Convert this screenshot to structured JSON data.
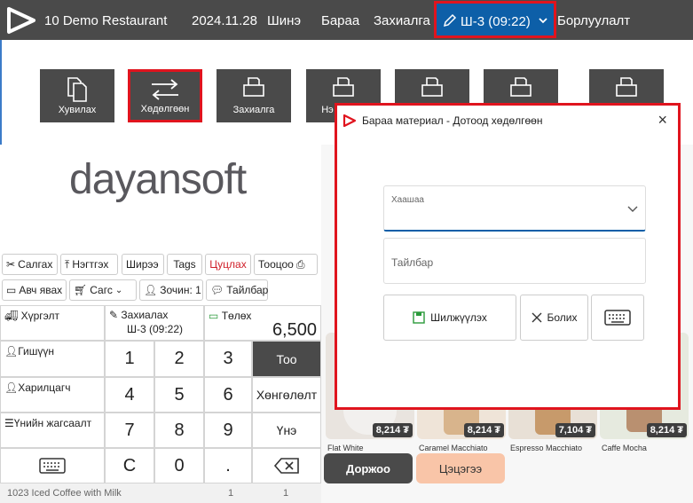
{
  "header": {
    "restaurant": "10 Demo Restaurant",
    "date": "2024.11.28",
    "menu": [
      "Шинэ",
      "Бараа",
      "Захиалга"
    ],
    "order_tab": "Ш-3 (09:22)",
    "sales": "Борлуулалт"
  },
  "actions": [
    "Хувилах",
    "Хөдөлгөөн",
    "Захиалга",
    "Нэ"
  ],
  "brand": "dayansoft",
  "toolbar": {
    "row1": [
      "Салгах",
      "Нэгтгэх",
      "Ширээ",
      "Tags",
      "Цуцлах",
      "Тооцоо"
    ],
    "row2": [
      "Авч явах",
      "Сагс",
      "Зочин: 1",
      "Тайлбар"
    ]
  },
  "info": {
    "delivery": "Хүргэлт",
    "order_label": "Захиалах",
    "order_value": "Ш-3 (09:22)",
    "payment": "Төлөх",
    "amount": "6,500",
    "guest": "Гишүүн",
    "customer": "Харилцагч",
    "discount": "Үнийн жагсаалт"
  },
  "keypad": {
    "digits": [
      "1",
      "2",
      "3",
      "4",
      "5",
      "6",
      "7",
      "8",
      "9",
      "C",
      "0",
      "."
    ],
    "quantity": "Тоо",
    "discount": "Хөнгөлөлт",
    "price": "Үнэ"
  },
  "status": {
    "item": "1023 Iced Coffee with Milk",
    "qty": "1",
    "count": "1"
  },
  "products": {
    "prices": [
      "8,214 ₮",
      "8,214 ₮",
      "7,104 ₮",
      "8,214 ₮"
    ],
    "names": [
      "Flat White",
      "Caramel Macchiato",
      "Espresso Macchiato",
      "Caffe Mocha"
    ]
  },
  "buttons": {
    "doorzoo": "Доржоо",
    "clear": "Цэцэгээ"
  },
  "modal": {
    "title": "Бараа материал - Дотоод хөдөлгөөн",
    "destination_label": "Хаашаа",
    "description_placeholder": "Тайлбар",
    "save": "Шилжүүлэх",
    "cancel": "Болих"
  },
  "colors": {
    "accent_red": "#e0141e",
    "dark": "#4a4a4a",
    "blue": "#0d5fa8",
    "peach": "#f9c5a8"
  }
}
